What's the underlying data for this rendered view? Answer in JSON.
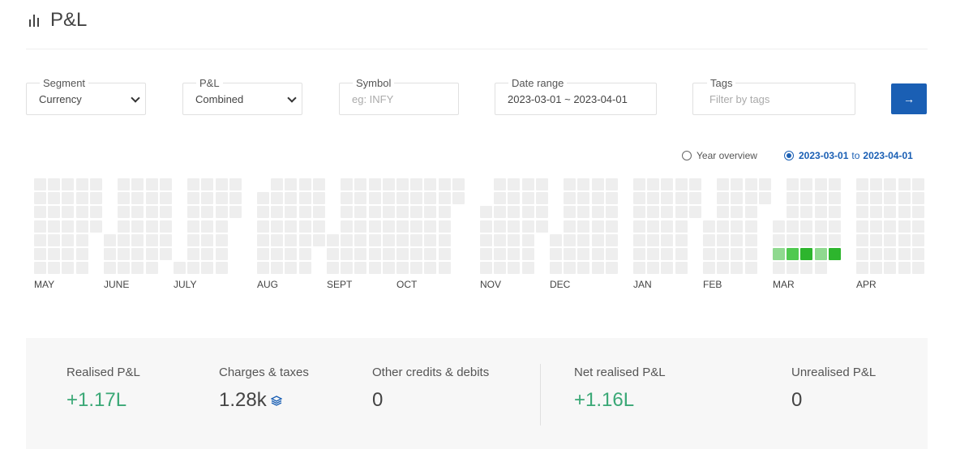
{
  "header": {
    "title": "P&L",
    "icon": "bar-chart-icon"
  },
  "filters": {
    "segment": {
      "label": "Segment",
      "value": "Currency"
    },
    "pnl": {
      "label": "P&L",
      "value": "Combined"
    },
    "symbol": {
      "label": "Symbol",
      "placeholder": "eg: INFY"
    },
    "date_range": {
      "label": "Date range",
      "value": "2023-03-01 ~ 2023-04-01"
    },
    "tags": {
      "label": "Tags",
      "placeholder": "Filter by tags"
    },
    "submit_icon": "arrow-right-icon",
    "submit_label": "→"
  },
  "view_toggle": {
    "year_overview_label": "Year overview",
    "range_from": "2023-03-01",
    "range_to_word": "to",
    "range_to": "2023-04-01",
    "selected": "range"
  },
  "heatmap": {
    "months": [
      {
        "label": "MAY",
        "weeks": [
          [
            0,
            0,
            0,
            0,
            0,
            0,
            0
          ],
          [
            0,
            0,
            0,
            0,
            0,
            0,
            0
          ],
          [
            0,
            0,
            0,
            0,
            0,
            0,
            0
          ],
          [
            0,
            0,
            0,
            0,
            0,
            0,
            0
          ],
          [
            0,
            0,
            0,
            0,
            null,
            null,
            null
          ]
        ]
      },
      {
        "label": "JUNE",
        "weeks": [
          [
            null,
            null,
            null,
            null,
            0,
            0,
            0
          ],
          [
            0,
            0,
            0,
            0,
            0,
            0,
            0
          ],
          [
            0,
            0,
            0,
            0,
            0,
            0,
            0
          ],
          [
            0,
            0,
            0,
            0,
            0,
            0,
            0
          ],
          [
            0,
            0,
            0,
            0,
            0,
            0,
            null
          ]
        ]
      },
      {
        "label": "JULY",
        "weeks": [
          [
            null,
            null,
            null,
            null,
            null,
            null,
            0
          ],
          [
            0,
            0,
            0,
            0,
            0,
            0,
            0
          ],
          [
            0,
            0,
            0,
            0,
            0,
            0,
            0
          ],
          [
            0,
            0,
            0,
            0,
            0,
            0,
            0
          ],
          [
            0,
            0,
            0,
            null,
            null,
            null,
            null
          ]
        ]
      },
      {
        "label": "AUG",
        "weeks": [
          [
            null,
            0,
            0,
            0,
            0,
            0,
            0
          ],
          [
            0,
            0,
            0,
            0,
            0,
            0,
            0
          ],
          [
            0,
            0,
            0,
            0,
            0,
            0,
            0
          ],
          [
            0,
            0,
            0,
            0,
            0,
            0,
            0
          ],
          [
            0,
            0,
            0,
            0,
            0,
            null,
            null
          ]
        ]
      },
      {
        "label": "SEPT",
        "weeks": [
          [
            null,
            null,
            null,
            null,
            0,
            0,
            0
          ],
          [
            0,
            0,
            0,
            0,
            0,
            0,
            0
          ],
          [
            0,
            0,
            0,
            0,
            0,
            0,
            0
          ],
          [
            0,
            0,
            0,
            0,
            0,
            0,
            0
          ],
          [
            0,
            0,
            0,
            0,
            0,
            0,
            0
          ]
        ]
      },
      {
        "label": "OCT",
        "weeks": [
          [
            0,
            0,
            0,
            0,
            0,
            0,
            0
          ],
          [
            0,
            0,
            0,
            0,
            0,
            0,
            0
          ],
          [
            0,
            0,
            0,
            0,
            0,
            0,
            0
          ],
          [
            0,
            0,
            0,
            0,
            0,
            0,
            0
          ],
          [
            0,
            0,
            null,
            null,
            null,
            null,
            null
          ]
        ]
      },
      {
        "label": "NOV",
        "weeks": [
          [
            null,
            null,
            0,
            0,
            0,
            0,
            0
          ],
          [
            0,
            0,
            0,
            0,
            0,
            0,
            0
          ],
          [
            0,
            0,
            0,
            0,
            0,
            0,
            0
          ],
          [
            0,
            0,
            0,
            0,
            0,
            0,
            0
          ],
          [
            0,
            0,
            0,
            0,
            null,
            null,
            null
          ]
        ]
      },
      {
        "label": "DEC",
        "weeks": [
          [
            null,
            null,
            null,
            null,
            0,
            0,
            0
          ],
          [
            0,
            0,
            0,
            0,
            0,
            0,
            0
          ],
          [
            0,
            0,
            0,
            0,
            0,
            0,
            0
          ],
          [
            0,
            0,
            0,
            0,
            0,
            0,
            0
          ],
          [
            0,
            0,
            0,
            0,
            0,
            0,
            0
          ]
        ]
      },
      {
        "label": "JAN",
        "weeks": [
          [
            0,
            0,
            0,
            0,
            0,
            0,
            0
          ],
          [
            0,
            0,
            0,
            0,
            0,
            0,
            0
          ],
          [
            0,
            0,
            0,
            0,
            0,
            0,
            0
          ],
          [
            0,
            0,
            0,
            0,
            0,
            0,
            0
          ],
          [
            0,
            0,
            0,
            null,
            null,
            null,
            null
          ]
        ]
      },
      {
        "label": "FEB",
        "weeks": [
          [
            null,
            null,
            null,
            0,
            0,
            0,
            0
          ],
          [
            0,
            0,
            0,
            0,
            0,
            0,
            0
          ],
          [
            0,
            0,
            0,
            0,
            0,
            0,
            0
          ],
          [
            0,
            0,
            0,
            0,
            0,
            0,
            0
          ],
          [
            0,
            0,
            null,
            null,
            null,
            null,
            null
          ]
        ]
      },
      {
        "label": "MAR",
        "weeks": [
          [
            null,
            null,
            null,
            0,
            0,
            1,
            0
          ],
          [
            0,
            0,
            0,
            0,
            0,
            2,
            0
          ],
          [
            0,
            0,
            0,
            0,
            0,
            3,
            0
          ],
          [
            0,
            0,
            0,
            0,
            0,
            1,
            0
          ],
          [
            0,
            0,
            0,
            0,
            0,
            3,
            null
          ]
        ]
      },
      {
        "label": "APR",
        "weeks": [
          [
            0,
            0,
            0,
            0,
            0,
            0,
            0
          ],
          [
            0,
            0,
            0,
            0,
            0,
            0,
            0
          ],
          [
            0,
            0,
            0,
            0,
            0,
            0,
            0
          ],
          [
            0,
            0,
            0,
            0,
            0,
            0,
            0
          ],
          [
            0,
            0,
            0,
            0,
            0,
            0,
            0
          ]
        ]
      }
    ],
    "colors": {
      "0": "#eeeeee",
      "1": "#8fd98f",
      "2": "#4fc94f",
      "3": "#2db52d"
    }
  },
  "summary": {
    "realised": {
      "label": "Realised P&L",
      "value": "+1.17L"
    },
    "charges": {
      "label": "Charges & taxes",
      "value": "1.28k",
      "icon": "layers-icon"
    },
    "other": {
      "label": "Other credits & debits",
      "value": "0"
    },
    "net": {
      "label": "Net realised P&L",
      "value": "+1.16L"
    },
    "unrealised": {
      "label": "Unrealised P&L",
      "value": "0"
    }
  }
}
